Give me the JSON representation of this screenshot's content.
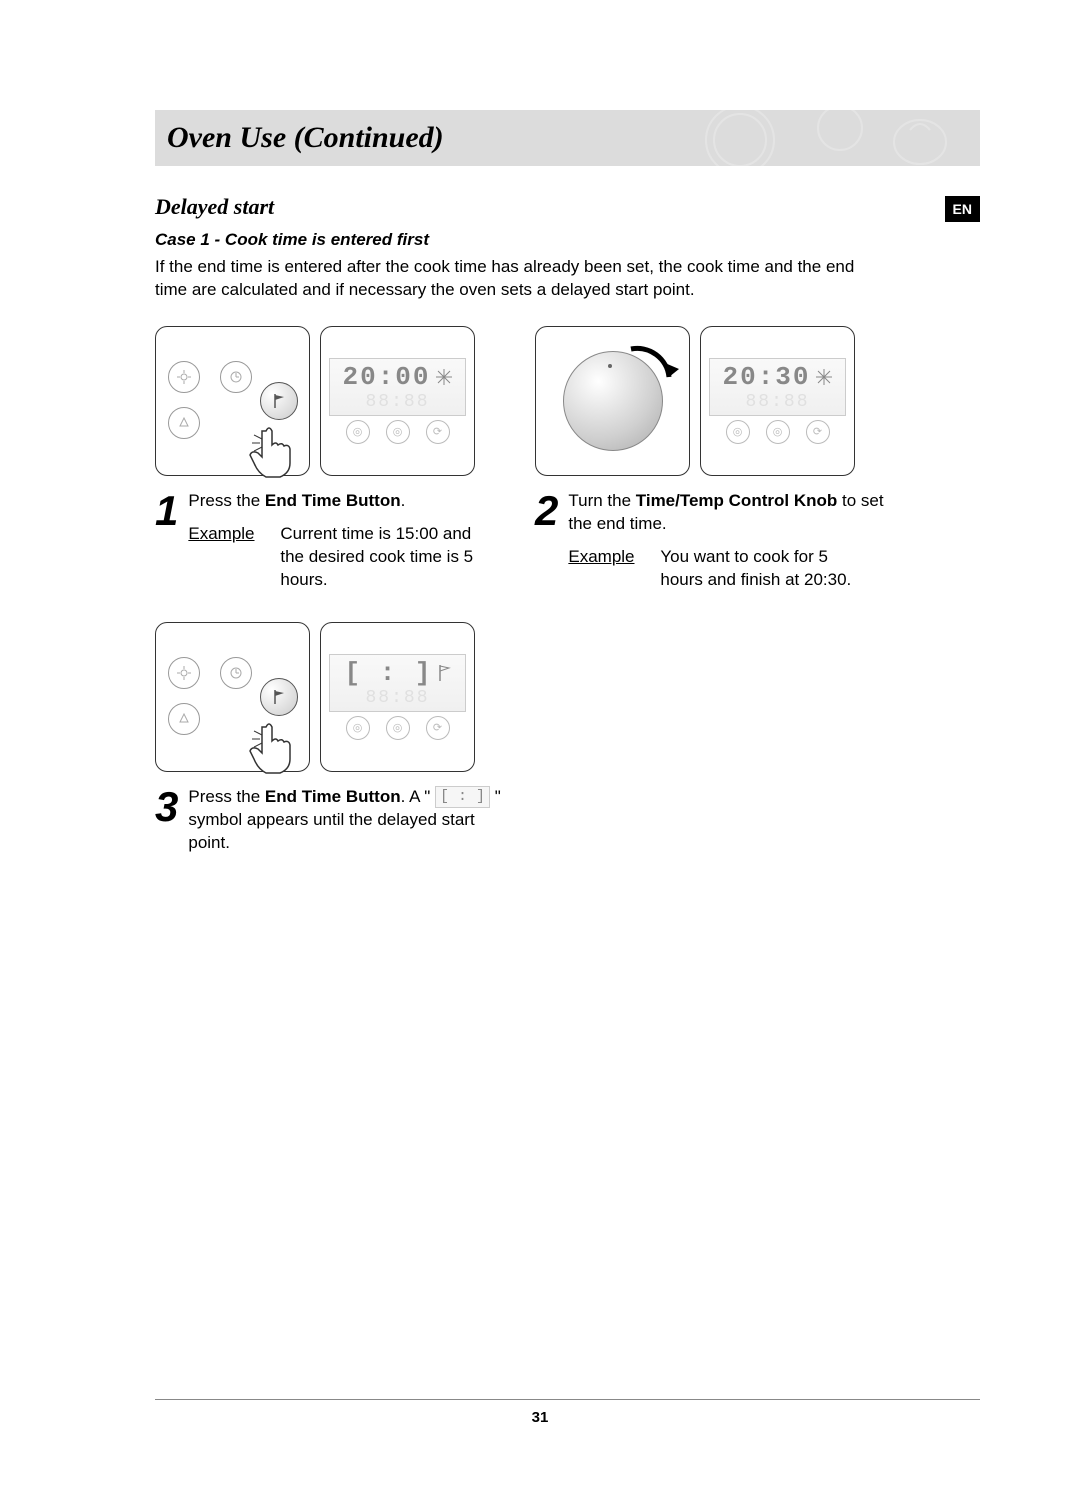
{
  "language_tab": "EN",
  "page_title": "Oven Use (Continued)",
  "section": "Delayed start",
  "case_heading": "Case 1 - Cook time is entered first",
  "intro": "If the end time is entered after the cook time has already been set, the cook time and the end time are calculated and if necessary the oven sets a delayed start point.",
  "displays": {
    "step1": "20:00",
    "step2": "20:30",
    "step3_symbol": "[ :  ]",
    "ghost": "88:88"
  },
  "steps": {
    "s1": {
      "num": "1",
      "text_pre": "Press the ",
      "bold": "End Time Button",
      "text_post": ".",
      "example_label": "Example",
      "example_text": "Current time is 15:00 and the desired cook time is 5 hours."
    },
    "s2": {
      "num": "2",
      "text_pre": "Turn the ",
      "bold": "Time/Temp Control Knob",
      "text_post": " to set the end time.",
      "example_label": "Example",
      "example_text": "You want to cook for 5 hours and finish at 20:30."
    },
    "s3": {
      "num": "3",
      "text_pre": "Press the ",
      "bold": "End Time Button",
      "text_post1": ". A \" ",
      "text_post2": " \" symbol appears until the delayed start point."
    }
  },
  "page_number": "31"
}
